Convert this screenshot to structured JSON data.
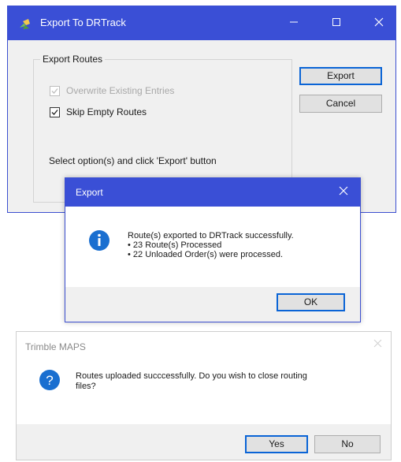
{
  "export_window": {
    "title": "Export To DRTrack",
    "group_label": "Export Routes",
    "options": [
      {
        "label": "Overwrite Existing Entries",
        "checked": true,
        "disabled": true
      },
      {
        "label": "Skip Empty Routes",
        "checked": true,
        "disabled": false
      }
    ],
    "instructions": "Select option(s) and click 'Export' button",
    "export_button": "Export",
    "cancel_button": "Cancel",
    "minimize_icon": "minimize-icon",
    "maximize_icon": "maximize-icon",
    "close_icon": "close-icon",
    "accent_color": "#3a4fd6"
  },
  "export_message": {
    "title": "Export",
    "icon": "info-icon",
    "lines": [
      "Route(s) exported to DRTrack successfully.",
      "• 23 Route(s) Processed",
      "• 22 Unloaded Order(s) were processed."
    ],
    "ok_button": "OK"
  },
  "trimble_dialog": {
    "title": "Trimble MAPS",
    "icon": "question-icon",
    "message_lines": [
      "Routes uploaded succcessfully. Do you wish to close routing",
      "files?"
    ],
    "yes_button": "Yes",
    "no_button": "No"
  }
}
